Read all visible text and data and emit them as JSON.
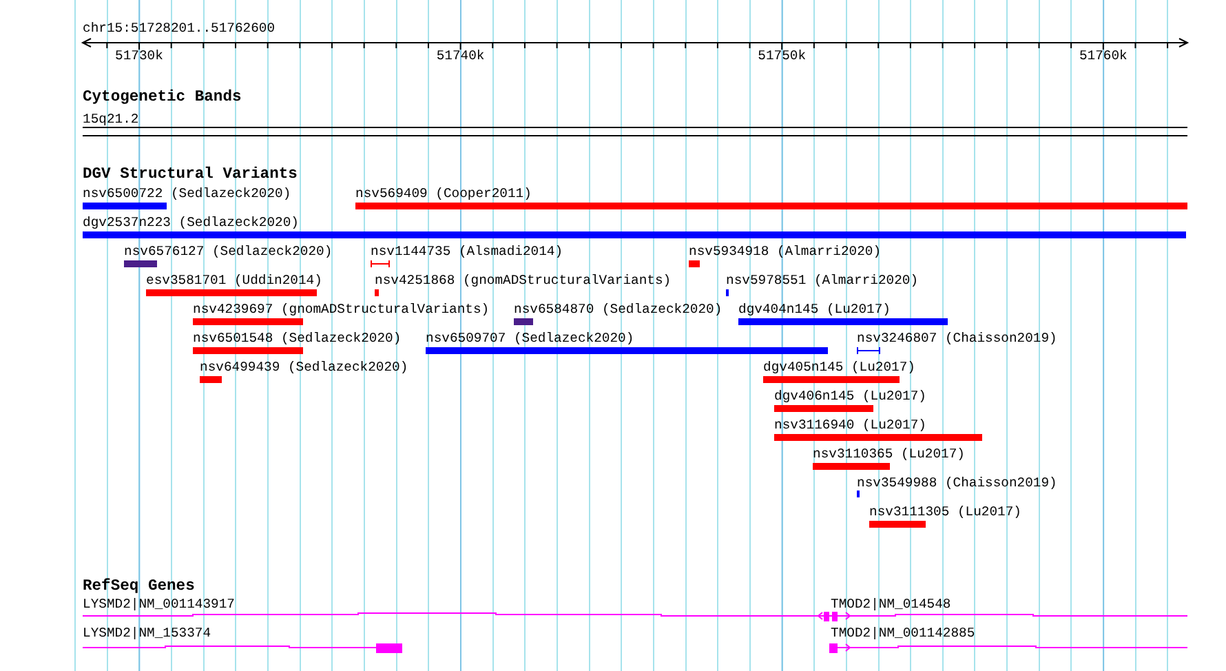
{
  "ruler": {
    "position": "chr15:51728201..51762600",
    "tick_labels": [
      "51730k",
      "51740k",
      "51750k",
      "51760k"
    ]
  },
  "cytogenetic_bands": {
    "title": "Cytogenetic Bands",
    "band": "15q21.2"
  },
  "structural_variants": {
    "title": "DGV Structural Variants",
    "rows": [
      {
        "features": [
          {
            "label": "nsv6500722 (Sedlazeck2020)",
            "color": "#0000ff",
            "kind": "bar"
          },
          {
            "label": "nsv569409 (Cooper2011)",
            "color": "#ff0000",
            "kind": "bar"
          }
        ]
      },
      {
        "features": [
          {
            "label": "dgv2537n223 (Sedlazeck2020)",
            "color": "#0000ff",
            "kind": "bar"
          }
        ]
      },
      {
        "features": [
          {
            "label": "nsv6576127 (Sedlazeck2020)",
            "color": "#4a1e8a",
            "kind": "bar"
          },
          {
            "label": "nsv1144735 (Alsmadi2014)",
            "color": "#ff0000",
            "kind": "span"
          },
          {
            "label": "nsv5934918 (Almarri2020)",
            "color": "#ff0000",
            "kind": "bar"
          }
        ]
      },
      {
        "features": [
          {
            "label": "esv3581701 (Uddin2014)",
            "color": "#ff0000",
            "kind": "bar"
          },
          {
            "label": "nsv4251868 (gnomADStructuralVariants)",
            "color": "#ff0000",
            "kind": "bar"
          },
          {
            "label": "nsv5978551 (Almarri2020)",
            "color": "#0000ff",
            "kind": "bar"
          }
        ]
      },
      {
        "features": [
          {
            "label": "nsv4239697 (gnomADStructuralVariants)",
            "color": "#ff0000",
            "kind": "bar"
          },
          {
            "label": "nsv6584870 (Sedlazeck2020)",
            "color": "#4a1e8a",
            "kind": "bar"
          },
          {
            "label": "dgv404n145 (Lu2017)",
            "color": "#0000ff",
            "kind": "bar"
          }
        ]
      },
      {
        "features": [
          {
            "label": "nsv6501548 (Sedlazeck2020)",
            "color": "#ff0000",
            "kind": "bar"
          },
          {
            "label": "nsv6509707 (Sedlazeck2020)",
            "color": "#0000ff",
            "kind": "bar"
          },
          {
            "label": "nsv3246807 (Chaisson2019)",
            "color": "#0000ff",
            "kind": "span"
          }
        ]
      },
      {
        "features": [
          {
            "label": "nsv6499439 (Sedlazeck2020)",
            "color": "#ff0000",
            "kind": "bar"
          },
          {
            "label": "dgv405n145 (Lu2017)",
            "color": "#ff0000",
            "kind": "bar"
          }
        ]
      },
      {
        "features": [
          {
            "label": "dgv406n145 (Lu2017)",
            "color": "#ff0000",
            "kind": "bar"
          }
        ]
      },
      {
        "features": [
          {
            "label": "nsv3116940 (Lu2017)",
            "color": "#ff0000",
            "kind": "bar"
          }
        ]
      },
      {
        "features": [
          {
            "label": "nsv3110365 (Lu2017)",
            "color": "#ff0000",
            "kind": "bar"
          }
        ]
      },
      {
        "features": [
          {
            "label": "nsv3549988 (Chaisson2019)",
            "color": "#0000ff",
            "kind": "bar"
          }
        ]
      },
      {
        "features": [
          {
            "label": "nsv3111305 (Lu2017)",
            "color": "#ff0000",
            "kind": "bar"
          }
        ]
      }
    ]
  },
  "refseq_genes": {
    "title": "RefSeq Genes",
    "rows": [
      {
        "genes": [
          {
            "label": "LYSMD2|NM_001143917"
          },
          {
            "label": "TMOD2|NM_014548"
          }
        ]
      },
      {
        "genes": [
          {
            "label": "LYSMD2|NM_153374"
          },
          {
            "label": "TMOD2|NM_001142885"
          }
        ]
      }
    ]
  }
}
